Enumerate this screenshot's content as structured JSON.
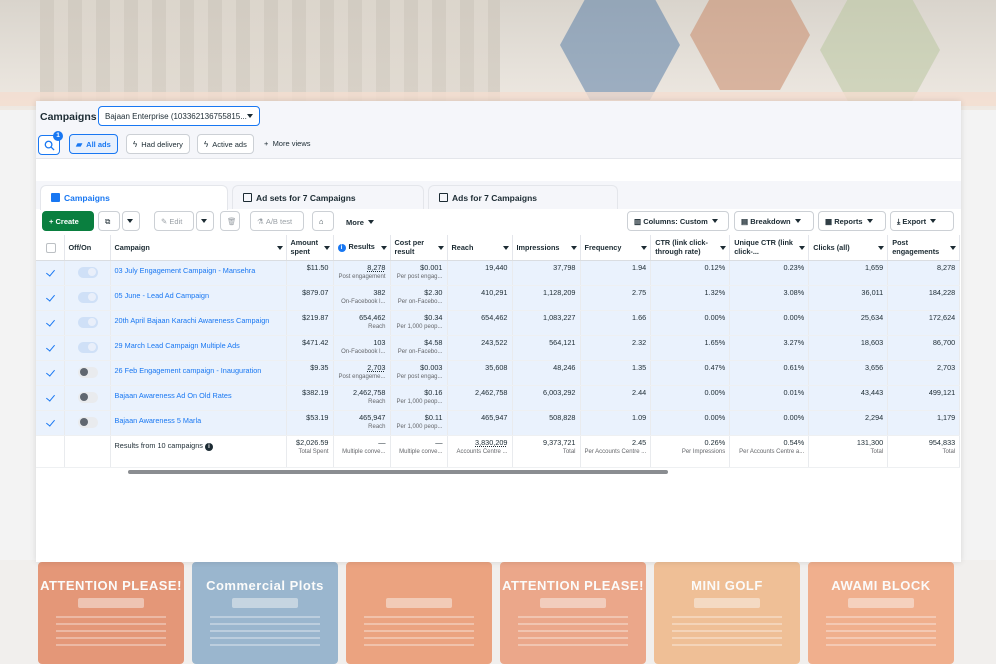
{
  "top_bar": {
    "title": "Campaigns",
    "account": "Bajaan Enterprise (103362136755815...",
    "search_badge": "1",
    "views": [
      {
        "label": "All ads",
        "icon": "folder-icon",
        "active": true
      },
      {
        "label": "Had delivery",
        "icon": "bolt-icon",
        "active": false
      },
      {
        "label": "Active ads",
        "icon": "bolt-icon",
        "active": false
      }
    ],
    "more_views": "More views"
  },
  "tabs": [
    {
      "label": "Campaigns",
      "active": true
    },
    {
      "label": "Ad sets for 7 Campaigns",
      "active": false
    },
    {
      "label": "Ads for 7 Campaigns",
      "active": false
    }
  ],
  "toolbar": {
    "create": "Create",
    "edit": "Edit",
    "ab_test": "A/B test",
    "more": "More",
    "columns": "Columns: Custom",
    "breakdown": "Breakdown",
    "reports": "Reports",
    "export": "Export"
  },
  "table": {
    "headers": {
      "off_on": "Off/On",
      "campaign": "Campaign",
      "amount_spent": "Amount spent",
      "results": "Results",
      "cost_per_result": "Cost per result",
      "reach": "Reach",
      "impressions": "Impressions",
      "frequency": "Frequency",
      "ctr": "CTR (link click-through rate)",
      "unique_ctr": "Unique CTR (link click-...",
      "clicks_all": "Clicks (all)",
      "post_engagements": "Post engagements"
    },
    "rows": [
      {
        "name": "03 July Engagement Campaign - Mansehra",
        "toggle": "on",
        "spent": "$11.50",
        "results": "8,278",
        "results_sub": "Post engagement",
        "cpr": "$0.001",
        "cpr_sub": "Per post engag...",
        "reach": "19,440",
        "impressions": "37,798",
        "frequency": "1.94",
        "ctr": "0.12%",
        "uctr": "0.23%",
        "clicks": "1,659",
        "engagements": "8,278"
      },
      {
        "name": "05 June - Lead Ad Campaign",
        "toggle": "on",
        "spent": "$879.07",
        "results": "382",
        "results_sub": "On-Facebook l...",
        "cpr": "$2.30",
        "cpr_sub": "Per on-Facebo...",
        "reach": "410,291",
        "impressions": "1,128,209",
        "frequency": "2.75",
        "ctr": "1.32%",
        "uctr": "3.08%",
        "clicks": "36,011",
        "engagements": "184,228"
      },
      {
        "name": "20th April Bajaan Karachi Awareness Campaign",
        "toggle": "on",
        "spent": "$219.87",
        "results": "654,462",
        "results_sub": "Reach",
        "cpr": "$0.34",
        "cpr_sub": "Per 1,000 peop...",
        "reach": "654,462",
        "impressions": "1,083,227",
        "frequency": "1.66",
        "ctr": "0.00%",
        "uctr": "0.00%",
        "clicks": "25,634",
        "engagements": "172,624"
      },
      {
        "name": "29 March Lead Campaign Multiple Ads",
        "toggle": "on",
        "spent": "$471.42",
        "results": "103",
        "results_sub": "On-Facebook l...",
        "cpr": "$4.58",
        "cpr_sub": "Per on-Facebo...",
        "reach": "243,522",
        "impressions": "564,121",
        "frequency": "2.32",
        "ctr": "1.65%",
        "uctr": "3.27%",
        "clicks": "18,603",
        "engagements": "86,700"
      },
      {
        "name": "26 Feb Engagement campaign - Inauguration",
        "toggle": "off",
        "spent": "$9.35",
        "results": "2,703",
        "results_sub": "Post engageme...",
        "cpr": "$0.003",
        "cpr_sub": "Per post engag...",
        "reach": "35,608",
        "impressions": "48,246",
        "frequency": "1.35",
        "ctr": "0.47%",
        "uctr": "0.61%",
        "clicks": "3,656",
        "engagements": "2,703"
      },
      {
        "name": "Bajaan Awareness Ad On Old Rates",
        "toggle": "off",
        "spent": "$382.19",
        "results": "2,462,758",
        "results_sub": "Reach",
        "cpr": "$0.16",
        "cpr_sub": "Per 1,000 peop...",
        "reach": "2,462,758",
        "impressions": "6,003,292",
        "frequency": "2.44",
        "ctr": "0.00%",
        "uctr": "0.01%",
        "clicks": "43,443",
        "engagements": "499,121"
      },
      {
        "name": "Bajaan Awareness 5 Marla",
        "toggle": "off",
        "spent": "$53.19",
        "results": "465,947",
        "results_sub": "Reach",
        "cpr": "$0.11",
        "cpr_sub": "Per 1,000 peop...",
        "reach": "465,947",
        "impressions": "508,828",
        "frequency": "1.09",
        "ctr": "0.00%",
        "uctr": "0.00%",
        "clicks": "2,294",
        "engagements": "1,179"
      }
    ],
    "totals": {
      "label": "Results from 10 campaigns",
      "spent": "$2,026.59",
      "spent_sub": "Total Spent",
      "results": "—",
      "results_sub": "Multiple conve...",
      "cpr": "—",
      "cpr_sub": "Multiple conve...",
      "reach": "3,830,209",
      "reach_sub": "Accounts Centre ...",
      "impressions": "9,373,721",
      "impressions_sub": "Total",
      "frequency": "2.45",
      "frequency_sub": "Per Accounts Centre ...",
      "ctr": "0.26%",
      "ctr_sub": "Per Impressions",
      "uctr": "0.54%",
      "uctr_sub": "Per Accounts Centre a...",
      "clicks": "131,300",
      "clicks_sub": "Total",
      "engagements": "954,833",
      "engagements_sub": "Total"
    }
  },
  "posters": [
    {
      "title": "ATTENTION PLEASE!",
      "color": "#e07a52"
    },
    {
      "title": "Commercial Plots",
      "color": "#7ea4c4"
    },
    {
      "title": "",
      "color": "#e98a5c"
    },
    {
      "title": "ATTENTION PLEASE!",
      "color": "#e9906a"
    },
    {
      "title": "MINI GOLF",
      "color": "#efb079"
    },
    {
      "title": "AWAMI BLOCK",
      "color": "#f09a6e"
    }
  ],
  "colors": {
    "accent": "#1877f2",
    "create": "#0a7f3f",
    "row_highlight": "#eaf2fd"
  }
}
